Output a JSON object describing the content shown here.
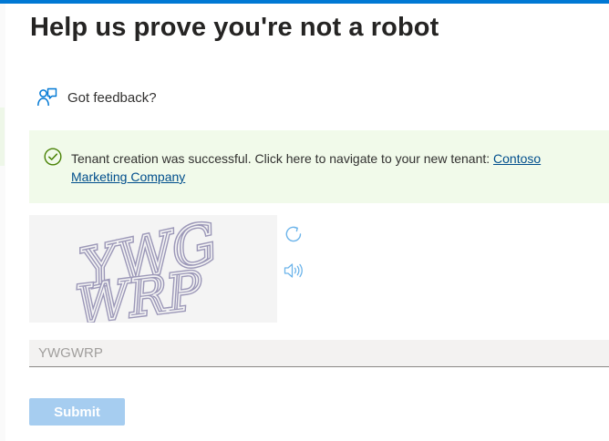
{
  "header": {
    "title": "Help us prove you're not a robot"
  },
  "feedback": {
    "icon": "feedback-person-icon",
    "label": "Got feedback?"
  },
  "banner": {
    "icon": "check-circle-icon",
    "message": "Tenant creation was successful. Click here to navigate to your new tenant: ",
    "link_text": "Contoso Marketing Company"
  },
  "captcha": {
    "image_text_line1": "YWG",
    "image_text_line2": "WRP",
    "refresh_icon": "refresh-icon",
    "audio_icon": "speaker-icon"
  },
  "form": {
    "input_value": "YWGWRP",
    "submit_label": "Submit"
  },
  "colors": {
    "accent": "#0078d4",
    "banner_background": "#f1faea",
    "success_icon": "#498205",
    "link": "#004e8c",
    "submit_disabled": "#a6cdf0"
  }
}
